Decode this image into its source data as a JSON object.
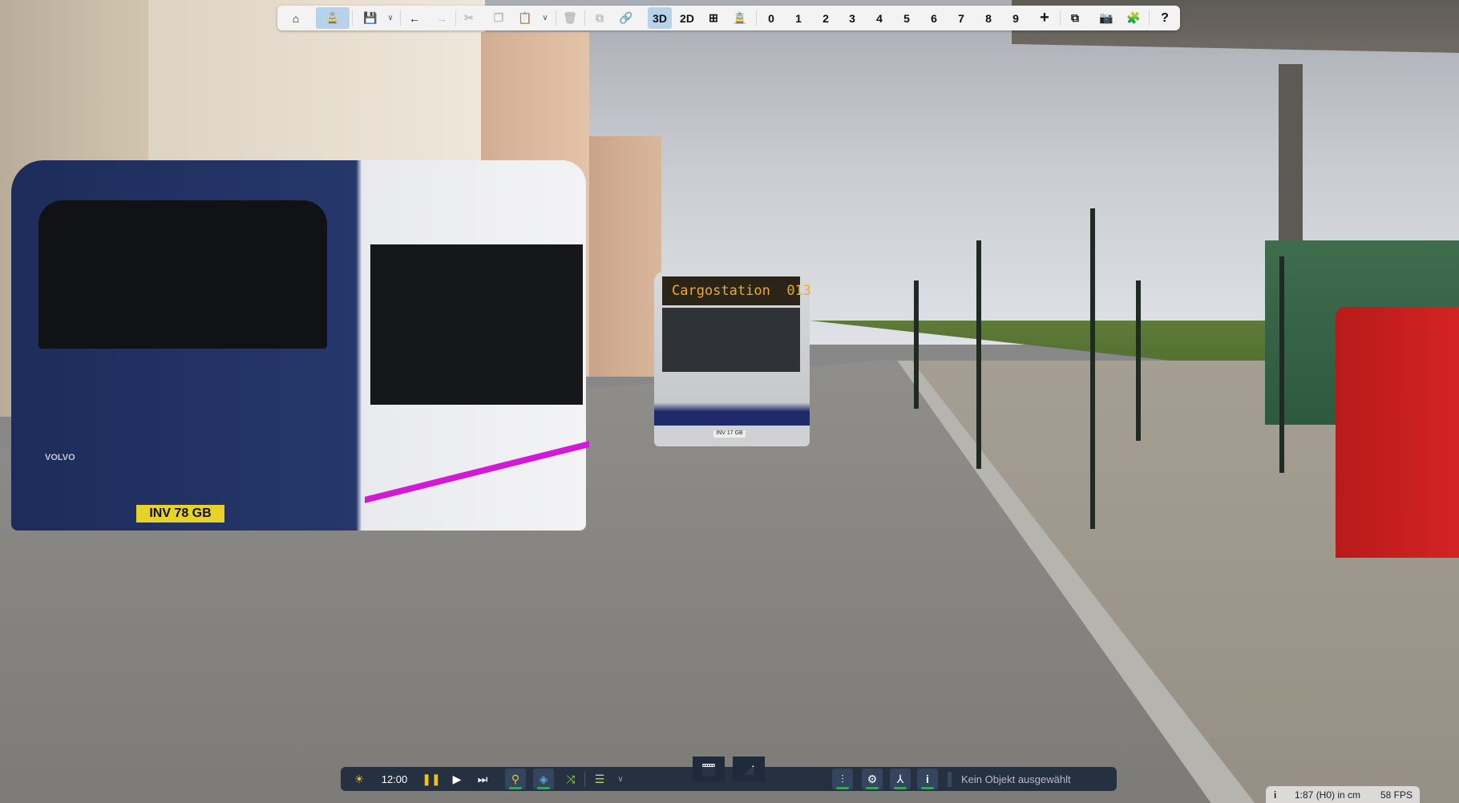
{
  "scene": {
    "bus_destination": "Cargostation",
    "bus_route": "013",
    "front_plate": "INV 78 GB",
    "rear_plate_small": "INV 17 GB",
    "bus_brand": "VOLVO"
  },
  "toolbar": {
    "items": [
      {
        "icon": "home-icon",
        "state": "enabled"
      },
      {
        "icon": "train-icon",
        "state": "active"
      },
      {
        "icon": "save-icon",
        "state": "enabled"
      },
      {
        "icon": "undo-arrow-icon",
        "state": "enabled"
      },
      {
        "icon": "redo-arrow-icon",
        "state": "disabled"
      },
      {
        "icon": "cut-icon",
        "state": "disabled"
      },
      {
        "icon": "copy-icon",
        "state": "disabled"
      },
      {
        "icon": "paste-icon",
        "state": "disabled"
      },
      {
        "icon": "delete-icon",
        "state": "disabled"
      },
      {
        "icon": "group-icon",
        "state": "disabled"
      },
      {
        "icon": "link-icon",
        "state": "disabled"
      }
    ],
    "view_3d": "3D",
    "view_2d": "2D",
    "layers": [
      "0",
      "1",
      "2",
      "3",
      "4",
      "5",
      "6",
      "7",
      "8",
      "9"
    ],
    "add": "+",
    "help": "?"
  },
  "bottombar": {
    "time": "12:00",
    "status": "Kein Objekt ausgewählt"
  },
  "infobar": {
    "info": "i",
    "scale": "1:87 (H0) in cm",
    "fps": "58 FPS"
  },
  "colors": {
    "accent_active": "#b9d2ec",
    "bar_bg": "#202c3e",
    "indicator": "#37a35c"
  }
}
